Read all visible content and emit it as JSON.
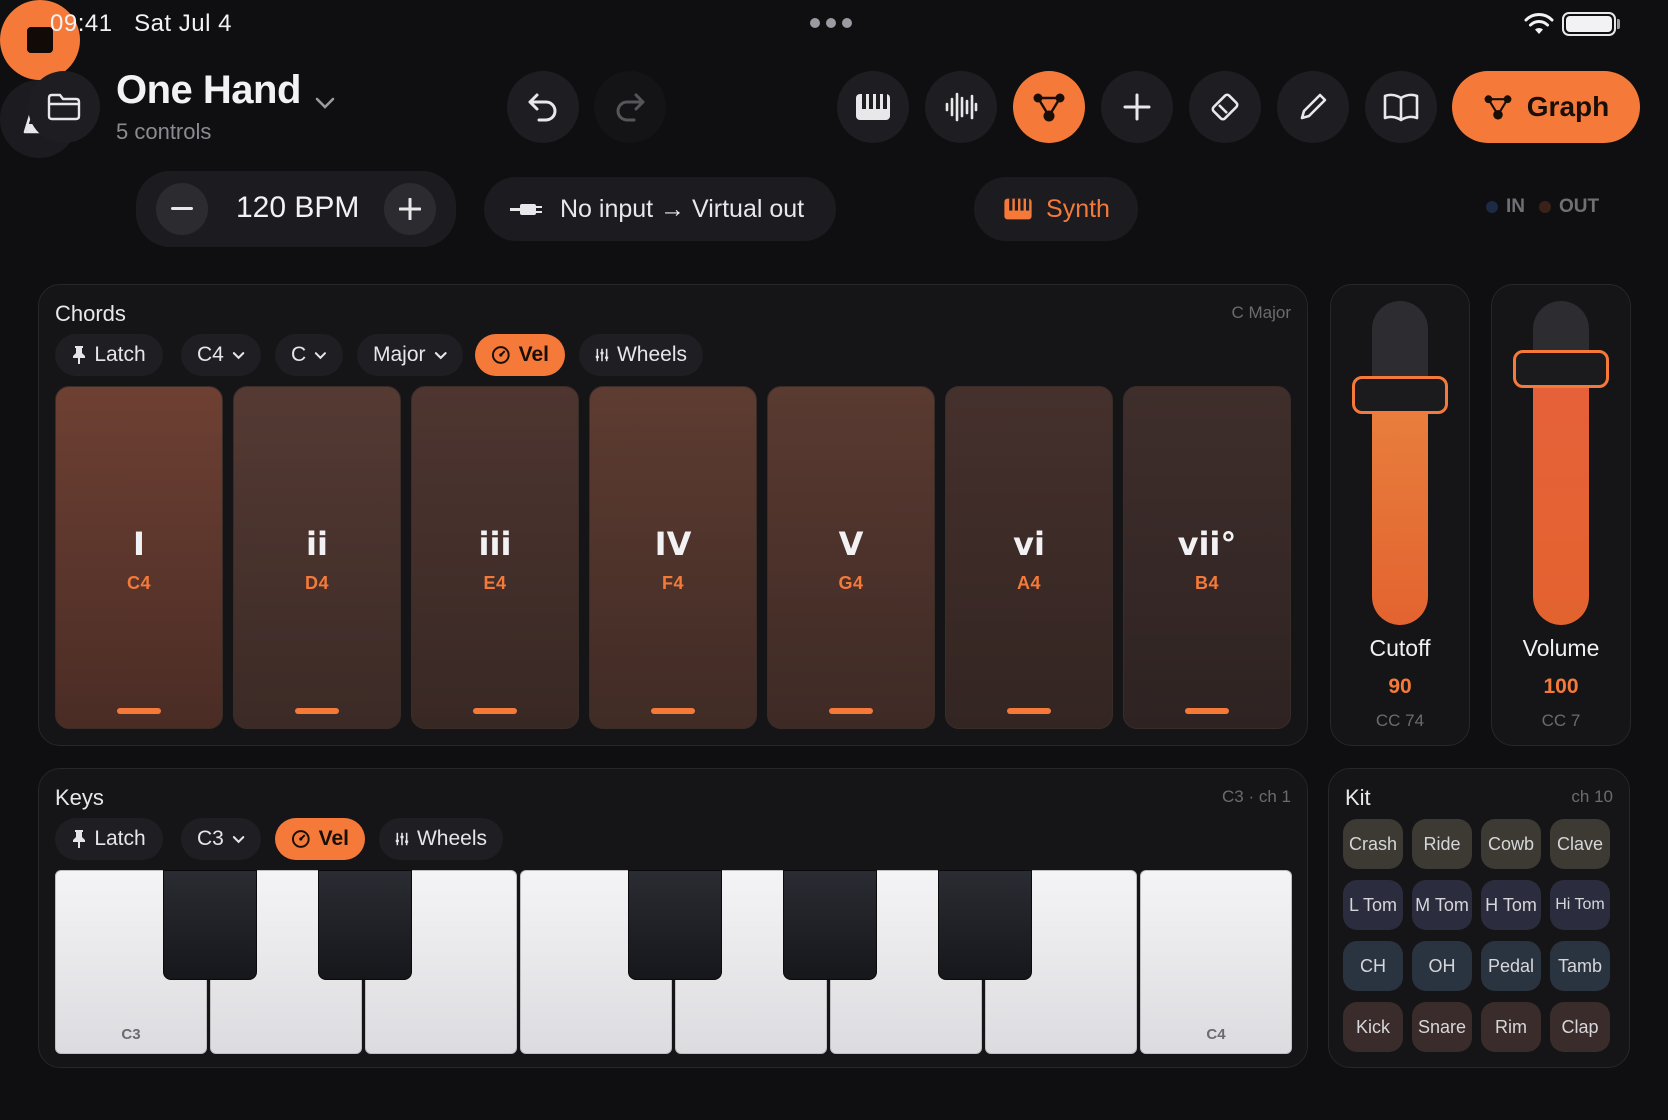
{
  "status": {
    "time": "09:41",
    "date": "Sat Jul 4"
  },
  "header": {
    "title": "One Hand",
    "subtitle": "5 controls",
    "graph_label": "Graph"
  },
  "transport": {
    "bpm": "120 BPM",
    "route": "No input → Virtual out",
    "instrument": "Synth",
    "in_label": "IN",
    "out_label": "OUT"
  },
  "chords": {
    "title": "Chords",
    "meta": "C Major",
    "chips": {
      "latch": "Latch",
      "octave": "C4",
      "root": "C",
      "scale": "Major",
      "vel": "Vel",
      "wheels": "Wheels"
    },
    "pads": [
      {
        "numeral": "I",
        "note": "C4"
      },
      {
        "numeral": "ii",
        "note": "D4"
      },
      {
        "numeral": "iii",
        "note": "E4"
      },
      {
        "numeral": "IV",
        "note": "F4"
      },
      {
        "numeral": "V",
        "note": "G4"
      },
      {
        "numeral": "vi",
        "note": "A4"
      },
      {
        "numeral": "vii°",
        "note": "B4"
      }
    ]
  },
  "faders": [
    {
      "label": "Cutoff",
      "value": "90",
      "cc": "CC 74",
      "level": 0.71,
      "color": "#e8803e"
    },
    {
      "label": "Volume",
      "value": "100",
      "cc": "CC 7",
      "level": 0.79,
      "color": "#e6603a"
    }
  ],
  "keys": {
    "title": "Keys",
    "meta": "C3 · ch 1",
    "chips": {
      "latch": "Latch",
      "octave": "C3",
      "vel": "Vel",
      "wheels": "Wheels"
    },
    "labels": {
      "low": "C3",
      "high": "C4"
    }
  },
  "kit": {
    "title": "Kit",
    "meta": "ch 10",
    "pads": [
      "Crash",
      "Ride",
      "Cowb",
      "Clave",
      "L Tom",
      "M Tom",
      "H Tom",
      "Hi Tom",
      "CH",
      "OH",
      "Pedal",
      "Tamb",
      "Kick",
      "Snare",
      "Rim",
      "Clap"
    ]
  },
  "colors": {
    "accent": "#f57a3a",
    "background": "#0f0f11",
    "panel": "#151518"
  }
}
